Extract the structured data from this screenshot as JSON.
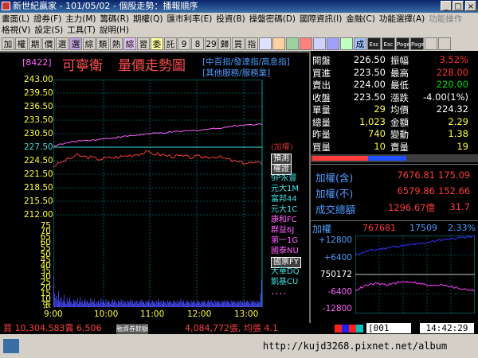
{
  "window": {
    "title": "新世紀贏家 - 101/05/02 - 個股走勢：播報順序"
  },
  "menu": {
    "row1": [
      "畫面(L)",
      "證券(F)",
      "主力(M)",
      "籌碼(R)",
      "期權(Q)",
      "匯市利率(E)",
      "投資(B)",
      "操盤密碼(D)",
      "國際資訊(I)",
      "金融(C)",
      "功能選擇(A)"
    ],
    "row1_dim": [
      "功能操作"
    ],
    "row2": [
      "格視(V)",
      "設定(S)",
      "工具(T)",
      "說明(H)"
    ]
  },
  "toolbar": {
    "buttons": [
      "加",
      "權",
      "期",
      "價",
      "選",
      "選",
      "綜",
      "類",
      "熱",
      "綜",
      "習",
      "委",
      "託",
      "9",
      "8",
      "29",
      "歸",
      "買",
      "指",
      "",
      "",
      "",
      "",
      "",
      "",
      "",
      "成",
      "Esc",
      "Esc",
      "Page",
      "Page",
      "",
      ""
    ]
  },
  "header": {
    "code": "[8422]",
    "name": "可寧衛",
    "title": "量價走勢圖",
    "link1": "[中百指/發達指/高息指]",
    "link2": "[其他服務/服務業]"
  },
  "price_axis": [
    "243.00",
    "239.50",
    "236.50",
    "233.50",
    "230.50",
    "227.50",
    "224.50",
    "221.50",
    "218.50",
    "215.50",
    "212.00"
  ],
  "volume_axis": [
    "75",
    "70",
    "65",
    "60",
    "55",
    "50",
    "45",
    "40",
    "35",
    "30",
    "25",
    "20",
    "15",
    "10",
    "張"
  ],
  "time_axis": [
    "9:00",
    "10:00",
    "11:00",
    "12:00",
    "13:00"
  ],
  "chart_data": [
    {
      "type": "line",
      "x": [
        "09:00",
        "09:30",
        "10:00",
        "10:30",
        "11:00",
        "11:30",
        "12:00",
        "12:30",
        "13:00",
        "13:30"
      ],
      "series": [
        {
          "values": [
            223.2,
            225.6,
            224.8,
            225.4,
            226.3,
            225.5,
            225.2,
            225.4,
            224.0,
            223.8
          ],
          "color": "#ff3b3b"
        },
        {
          "values": [
            227.8,
            228.9,
            229.3,
            229.9,
            230.5,
            230.9,
            231.3,
            231.8,
            232.5,
            232.8
          ],
          "color": "#ff60ff"
        }
      ],
      "reference_line": 227.5,
      "ylim": [
        212.0,
        243.0
      ]
    },
    {
      "type": "bar",
      "x": [
        "09:00",
        "13:30"
      ],
      "ylabel": "張",
      "ylim": [
        0,
        75
      ],
      "values": [
        28,
        12,
        8,
        10,
        6,
        14,
        5,
        7,
        9,
        4,
        6,
        11,
        5,
        3,
        8,
        4,
        6,
        9,
        5,
        4,
        3,
        7,
        5,
        6,
        4,
        8,
        3,
        5,
        9,
        4,
        6,
        3,
        5,
        7,
        4,
        6,
        5,
        3,
        4,
        8,
        5,
        6,
        4,
        7,
        3,
        5,
        4,
        6,
        3,
        5,
        8,
        4,
        6,
        5,
        3,
        7,
        4,
        5,
        6,
        4,
        3,
        5,
        7,
        4,
        6,
        5,
        4,
        3,
        6,
        5,
        4,
        7,
        5,
        3,
        6,
        4,
        5,
        3,
        6,
        4,
        5,
        7,
        4,
        6,
        3,
        5,
        4,
        6,
        5,
        3,
        4,
        6,
        5,
        7,
        4,
        5,
        3,
        6,
        4,
        5,
        6,
        4,
        3,
        5,
        6,
        4,
        5,
        3,
        6,
        4,
        7,
        5,
        4,
        6,
        3,
        5,
        6,
        4,
        5,
        3,
        6,
        4,
        5,
        6,
        4,
        3,
        5,
        6,
        4,
        5,
        3,
        6,
        4,
        5,
        7,
        4,
        5,
        6,
        3,
        4,
        5,
        6,
        4,
        5,
        3,
        6,
        4,
        5,
        6,
        4,
        3,
        5,
        6,
        4,
        5,
        3,
        6,
        4,
        5,
        6,
        4,
        3,
        5,
        6,
        4,
        5,
        6,
        4,
        5,
        3,
        6,
        4,
        5,
        6,
        4,
        5,
        3,
        6,
        4,
        5,
        6,
        4,
        5,
        6,
        4,
        5,
        3,
        6,
        4,
        5,
        6,
        4,
        5,
        3,
        6,
        4,
        5,
        6,
        4,
        5,
        3,
        6,
        4,
        5,
        6,
        4,
        5,
        3,
        6,
        4,
        5,
        6,
        4,
        5,
        3,
        6,
        4,
        5,
        12,
        24
      ],
      "color": "#4a4aff"
    },
    {
      "type": "line",
      "x": [
        "09:00",
        "13:30"
      ],
      "series": [
        {
          "values": [
            6400,
            7600,
            8200,
            8800,
            9300,
            9700,
            10100,
            10800,
            11400,
            11800,
            12200,
            12500
          ],
          "color": "#3030ff"
        },
        {
          "values": [
            -5200,
            -3600,
            -3000,
            -3400,
            -2600,
            -2300,
            -3000,
            -3800,
            -3200,
            -4200,
            -4800,
            -5200
          ],
          "color": "#ff40ff"
        }
      ],
      "reference_line": 0,
      "yticks": [
        "+12800",
        "+6400",
        "750172",
        "-6400",
        "-12800"
      ],
      "ylim": [
        -12800,
        12800
      ]
    }
  ],
  "broker_list": [
    {
      "label": "(加權)",
      "color": "#c03030"
    },
    {
      "label": "預測",
      "color": "#ffffff",
      "boxed": true
    },
    {
      "label": "權證",
      "color": "#ffffff",
      "boxed": true
    },
    {
      "label": "9P永豐",
      "color": "#40e0e0"
    },
    {
      "label": "元大1M",
      "color": "#40e0e0"
    },
    {
      "label": "富邦44",
      "color": "#40e0e0"
    },
    {
      "label": "元大1C",
      "color": "#40e0e0"
    },
    {
      "label": "康和FC",
      "color": "#ff60ff"
    },
    {
      "label": "群益6J",
      "color": "#ff60ff"
    },
    {
      "label": "第一1G",
      "color": "#ff60ff"
    },
    {
      "label": "國泰NU",
      "color": "#ff60ff"
    },
    {
      "label": "國票FY",
      "color": "#ffffff",
      "boxed": true
    },
    {
      "label": "大華DQ",
      "color": "#40e0e0"
    },
    {
      "label": "凱基CU",
      "color": "#40e0e0"
    },
    {
      "label": "．．．．",
      "color": "#ff60ff"
    }
  ],
  "quote": {
    "rows": [
      {
        "l1": "開盤",
        "v1": "226.50",
        "c1": "#ffffff",
        "l2": "振幅",
        "v2": "3.52%",
        "c2": "#ff3030"
      },
      {
        "l1": "買進",
        "v1": "223.50",
        "c1": "#ffffff",
        "l2": "最高",
        "v2": "228.00",
        "c2": "#ff3030"
      },
      {
        "l1": "賣出",
        "v1": "224.00",
        "c1": "#ffffff",
        "l2": "最低",
        "v2": "220.00",
        "c2": "#00e000"
      },
      {
        "l1": "收盤",
        "v1": "223.50",
        "c1": "#ffffff",
        "l2": "漲跌",
        "v2": "-4.00(1%)",
        "c2": "#ffffff"
      },
      {
        "l1": "單量",
        "v1": "29",
        "c1": "#ffff40",
        "l2": "均價",
        "v2": "224.32",
        "c2": "#ffffff"
      },
      {
        "l1": "總量",
        "v1": "1,023",
        "c1": "#ffff40",
        "l2": "金額",
        "v2": "2.29",
        "c2": "#ffff40"
      },
      {
        "l1": "昨量",
        "v1": "740",
        "c1": "#ffff40",
        "l2": "變動",
        "v2": "1.38",
        "c2": "#ffff40"
      },
      {
        "l1": "買量",
        "v1": "10",
        "c1": "#ffff40",
        "l2": "賣量",
        "v2": "19",
        "c2": "#ffff40"
      }
    ]
  },
  "index_panel": {
    "rows": [
      {
        "label": "加權(含)",
        "v1": "7676.81",
        "v2": "175.09"
      },
      {
        "label": "加權(不)",
        "v1": "6579.86",
        "v2": "152.66"
      },
      {
        "label": "成交總額",
        "v1": "1296.67億",
        "v2": "31.7"
      }
    ]
  },
  "mini_header": {
    "label": "加權",
    "value": "767681",
    "change": "17509",
    "pct": "2.33%"
  },
  "bottom": {
    "buy": "買 10,304,583賣 6,506",
    "mid": "融資券餘額",
    "sell": "4,084,772張, 均張 4.1",
    "code": "001",
    "time": "14:42:29"
  },
  "url": "http://kujd3268.pixnet.net/album"
}
